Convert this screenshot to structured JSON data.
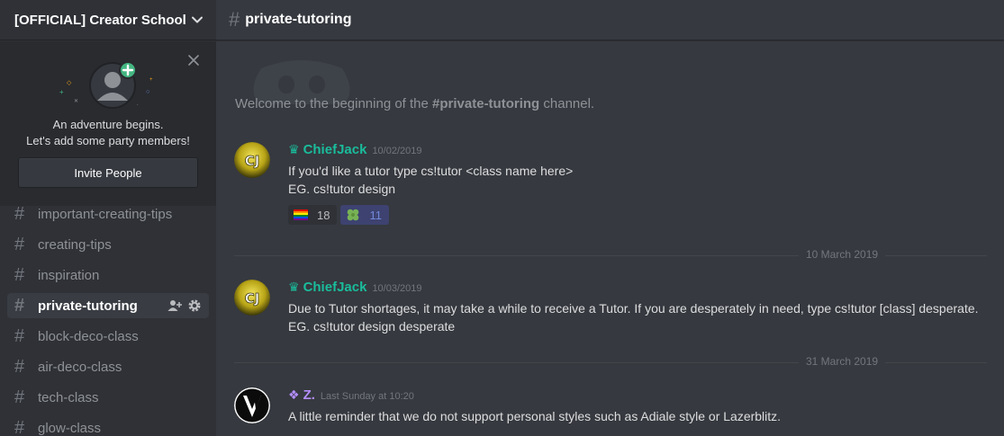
{
  "server": {
    "name": "[OFFICIAL] Creator School"
  },
  "invite": {
    "line1": "An adventure begins.",
    "line2": "Let's add some party members!",
    "button_label": "Invite People"
  },
  "channels": [
    {
      "name": "important-creating-tips"
    },
    {
      "name": "creating-tips"
    },
    {
      "name": "inspiration"
    },
    {
      "name": "private-tutoring",
      "active": true
    },
    {
      "name": "block-deco-class"
    },
    {
      "name": "air-deco-class"
    },
    {
      "name": "tech-class"
    },
    {
      "name": "glow-class"
    }
  ],
  "hash_symbol": "#",
  "topbar": {
    "channel": "private-tutoring"
  },
  "welcome": {
    "prefix": "Welcome to the beginning of the ",
    "channel": "#private-tutoring",
    "suffix": " channel."
  },
  "messages": [
    {
      "author": "ChiefJack",
      "author_color": "#1abc9c",
      "badge": "♛",
      "timestamp": "10/02/2019",
      "lines": [
        "If you'd like a tutor type cs!tutor <class name here>",
        "EG. cs!tutor design"
      ],
      "reactions": [
        {
          "emoji": "rainbow-flag",
          "count": "18"
        },
        {
          "emoji": "four-leaf-clover",
          "count": "11"
        }
      ]
    },
    {
      "author": "ChiefJack",
      "author_color": "#1abc9c",
      "badge": "♛",
      "timestamp": "10/03/2019",
      "lines": [
        "Due to Tutor shortages, it may take a while to receive a Tutor. If you are desperately in need, type cs!tutor [class] desperate.",
        "EG. cs!tutor design desperate"
      ]
    },
    {
      "author": "Z.",
      "author_color": "#b48efc",
      "badge": "❖",
      "timestamp": "Last Sunday at 10:20",
      "lines": [
        "A little reminder that we do not support personal styles such as Adiale style or Lazerblitz."
      ]
    }
  ],
  "dividers": [
    "10 March 2019",
    "31 March 2019"
  ]
}
